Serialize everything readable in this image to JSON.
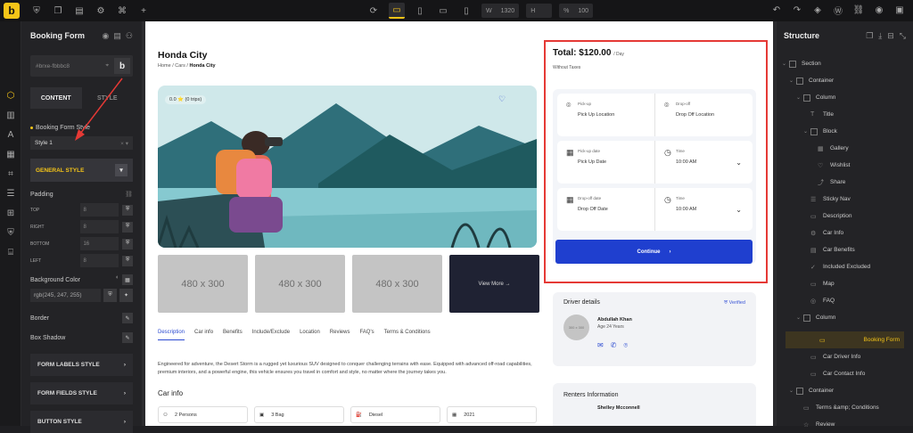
{
  "topbar": {
    "logo": "b",
    "width_label": "W",
    "width_value": "1320",
    "height_label": "H",
    "scale_label": "%",
    "scale_value": "100"
  },
  "left_panel": {
    "title": "Booking Form",
    "element_id": "#brxe-fbbbc8",
    "id_badge": "b",
    "tabs": [
      {
        "label": "CONTENT"
      },
      {
        "label": "STYLE"
      }
    ],
    "style_section_label": "Booking Form Style",
    "style_value": "Style 1",
    "general_style_label": "GENERAL STYLE",
    "padding_label": "Padding",
    "padding": [
      {
        "label": "TOP",
        "value": "8"
      },
      {
        "label": "RIGHT",
        "value": "8"
      },
      {
        "label": "BOTTOM",
        "value": "16"
      },
      {
        "label": "LEFT",
        "value": "8"
      }
    ],
    "bg_color_label": "Background Color",
    "bg_color_value": "rgb(245, 247, 255)",
    "border_label": "Border",
    "box_shadow_label": "Box Shadow",
    "groups": [
      {
        "label": "FORM LABELS STYLE"
      },
      {
        "label": "FORM FIELDS STYLE"
      },
      {
        "label": "BUTTON STYLE"
      }
    ]
  },
  "page": {
    "title": "Honda City",
    "breadcrumb": {
      "home": "Home",
      "cars": "Cars",
      "current": "Honda City"
    },
    "rating_badge": "0.0 ⭐ (0 trips)",
    "thumbs": [
      {
        "label": "480 x 300"
      },
      {
        "label": "480 x 300"
      },
      {
        "label": "480 x 300"
      },
      {
        "label": "View More →"
      }
    ],
    "nav_tabs": [
      {
        "label": "Description"
      },
      {
        "label": "Car info"
      },
      {
        "label": "Benefits"
      },
      {
        "label": "Include/Exclude"
      },
      {
        "label": "Location"
      },
      {
        "label": "Reviews"
      },
      {
        "label": "FAQ's"
      },
      {
        "label": "Terms & Conditions"
      }
    ],
    "description": "Engineered for adventure, the Desert Storm is a rugged yet luxurious SUV designed to conquer challenging terrains with ease. Equipped with advanced off-road capabilities, premium interiors, and a powerful engine, this vehicle ensures you travel in comfort and style, no matter where the journey takes you.",
    "car_info_title": "Car info",
    "car_info": [
      {
        "value": "2 Persons"
      },
      {
        "value": "3 Bag"
      },
      {
        "value": "Diesel"
      },
      {
        "value": "2021"
      }
    ]
  },
  "booking_form": {
    "total": "Total: $120.00",
    "per": "/ Day",
    "without_taxes": "Without Taxes",
    "pickup_label": "Pick-up",
    "pickup_value": "Pick Up Location",
    "dropoff_label": "Drop-off",
    "dropoff_value": "Drop Off Location",
    "pickup_date_label": "Pick-up date",
    "pickup_date_value": "Pick Up Date",
    "time_label": "Time",
    "pickup_time_value": "10:00 AM",
    "dropoff_date_label": "Drop-off date",
    "dropoff_date_value": "Drop Off Date",
    "dropoff_time_label": "Time",
    "dropoff_time_value": "10:00 AM",
    "continue_label": "Continue"
  },
  "driver": {
    "title": "Driver details",
    "verified": "Verified",
    "avatar_placeholder": "300 x 300",
    "name": "Abdullah Khan",
    "age": "Age 24 Years"
  },
  "renters": {
    "title": "Renters Information",
    "name": "Shelley Mcconnell"
  },
  "structure": {
    "title": "Structure",
    "nodes": [
      {
        "label": "Section"
      },
      {
        "label": "Container"
      },
      {
        "label": "Column"
      },
      {
        "label": "Title"
      },
      {
        "label": "Block"
      },
      {
        "label": "Gallery"
      },
      {
        "label": "Wishlist"
      },
      {
        "label": "Share"
      },
      {
        "label": "Sticky Nav"
      },
      {
        "label": "Description"
      },
      {
        "label": "Car Info"
      },
      {
        "label": "Car Benefits"
      },
      {
        "label": "Included Excluded"
      },
      {
        "label": "Map"
      },
      {
        "label": "FAQ"
      },
      {
        "label": "Column"
      },
      {
        "label": "Booking Form"
      },
      {
        "label": "Car Driver Info"
      },
      {
        "label": "Car Contact Info"
      },
      {
        "label": "Container"
      },
      {
        "label": "Terms &amp; Conditions"
      },
      {
        "label": "Review"
      }
    ]
  },
  "colors": {
    "accent": "#f5c518",
    "primary_button": "#1f3fcf",
    "annotation": "#e53935"
  }
}
